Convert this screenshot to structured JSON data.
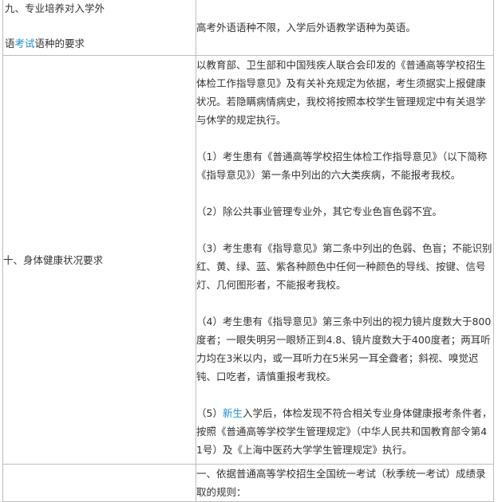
{
  "rows": [
    {
      "label_line1": "九、专业培养对入学外",
      "label_line2_prefix": "语",
      "label_line2_link": "考试",
      "label_line2_suffix": "语种的要求",
      "content": "高考外语语种不限，入学后外语教学语种为英语。"
    },
    {
      "label": "十、身体健康状况要求",
      "intro": "以教育部、卫生部和中国残疾人联合会印发的《普通高等学校招生体检工作指导意见》及有关补充规定为依据，考生须据实上报健康状况。若隐瞒病情病史，我校将按照本校学生管理规定中有关退学与休学的规定执行。",
      "items": [
        {
          "text": "（1）考生患有《普通高等学校招生体检工作指导意见》（以下简称《指导意见》）第一条中列出的六大类疾病，不能报考我校。"
        },
        {
          "text": "（2）除公共事业管理专业外，其它专业色盲色弱不宜。"
        },
        {
          "text": "（3）考生患有《指导意见》第二条中列出的色弱、色盲；不能识别红、黄、绿、蓝、紫各种颜色中任何一种颜色的导线、按键、信号灯、几何图形者，不能报考我校。"
        },
        {
          "text": "（4）考生患有《指导意见》第三条中列出的视力镜片度数大于800度者；一眼失明另一眼矫正到4.8、镜片度数大于400度者；两耳听力均在3米以内，或一耳听力在5米另一耳全聋者；斜视、嗅觉迟钝、口吃者，请慎重报考我校。"
        }
      ],
      "item5_prefix": "（5）",
      "item5_link": "新生",
      "item5_suffix": "入学后，体检发现不符合相关专业身体健康报考条件者，按照《普通高等学校学生管理规定》（中华人民共和国教育部令第41号）及《上海中医药大学学生管理规定》执行。"
    },
    {
      "label": "",
      "content": "一、依据普通高等学校招生全国统一考试（秋季统一考试）成绩录取的规则："
    }
  ],
  "colors": {
    "link": "#1a8cd8",
    "text": "#333333",
    "border": "#bdbdbd"
  }
}
